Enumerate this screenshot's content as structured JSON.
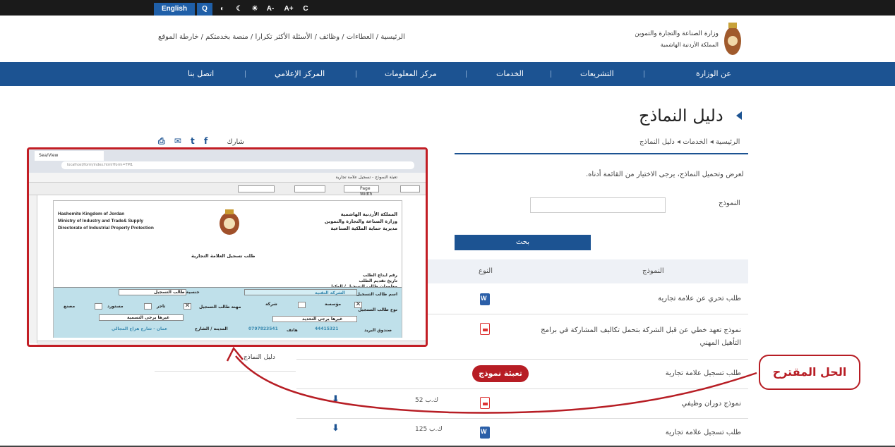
{
  "topbar": {
    "lang": "English",
    "search": "Q",
    "a_minus": "A-",
    "a_plus": "A+",
    "reset": "C"
  },
  "header": {
    "links_left": "الرئيسية / العطاءات / وظائف / الأسئلة الأكثر تكرارا / منصة بخدمتكم / خارطة الموقع",
    "logo_text": "وزارة الصناعة والتجارة والتموين - المملكة الأردنية الهاشمية"
  },
  "nav": [
    "عن الوزارة",
    "التشريعات",
    "الخدمات",
    "مركز المعلومات",
    "المركز الإعلامي",
    "اتصل بنا"
  ],
  "page": {
    "title": "دليل النماذج",
    "breadcrumb": "الرئيسية ◂ الخدمات ◂ دليل النماذج",
    "share": "شارك",
    "description": "لعرض وتحميل النماذج، يرجى الاختيار من القائمة أدناه.",
    "field_label": "النموذج",
    "search_button": "بحث",
    "table_head": {
      "name": "النموذج",
      "type": "النوع"
    },
    "rows": [
      {
        "name": "طلب تحري عن علامة تجارية",
        "type": "word",
        "size": "",
        "download": false
      },
      {
        "name": "نموذج تعهد خطي عن قبل الشركة بتحمل تكاليف المشاركة في برامج التأهيل المهني",
        "type": "pdf",
        "size": "",
        "download": false
      },
      {
        "name": "طلب تسجيل علامة تجارية",
        "type": "none",
        "size": "",
        "download": false
      },
      {
        "name": "نموذج دوران وظيفي",
        "type": "pdf",
        "size": "52 ك.ب",
        "download": true
      },
      {
        "name": "طلب تسجيل علامة تجارية",
        "type": "word",
        "size": "125 ك.ب",
        "download": true
      }
    ],
    "side_link": "دليل النماذج"
  },
  "overlay": {
    "tab": "Sea/View",
    "address": "localhost/form/index.html?form=TM1",
    "dialog_title": "تعبئة النموذج - تسجيل علامة تجارية",
    "page_width": "Page Width",
    "en_lines": [
      "Hashemite Kingdom of Jordan",
      "Ministry of Industry and Trade& Supply",
      "Directorate of Industrial Property Protection"
    ],
    "ar_lines": [
      "المملكة الأردنية الهاشمية",
      "وزارة الصناعة والتجارة والتموين",
      "مديرية حماية الملكية الصناعية"
    ],
    "form_title": "طلب تسجيل العلامة التجارية",
    "meta": [
      "رقم ايداع الطلب",
      "تاريخ تقديم الطلب",
      "معلومات طالب التسجيل / الوكيل"
    ],
    "applicant_label": "اسم طالب التسجيل",
    "applicant_value": "الشركة التقنية",
    "nationality_label": "جنسية طالب التسجيل",
    "type_label": "نوع طالب التسجيل",
    "type_options": [
      "مؤسسة",
      "شركة"
    ],
    "type_other": "غيرها يرجى التحديد",
    "job_label": "مهنة طالب التسجيل",
    "job_options": [
      "تاجر",
      "مستورد",
      "مصنع"
    ],
    "job_other": "غيرها يرجى التسمية",
    "address_row": [
      "صندوق البريد",
      "44415321",
      "هاتف",
      "0797823541",
      "المدينة / الشارع",
      "عمان - شارع هزاع المجالي"
    ]
  },
  "annotation": {
    "fill_label": "تعبئة نموذج",
    "callout": "الحل المقترح",
    "accent": "#b71d24"
  }
}
